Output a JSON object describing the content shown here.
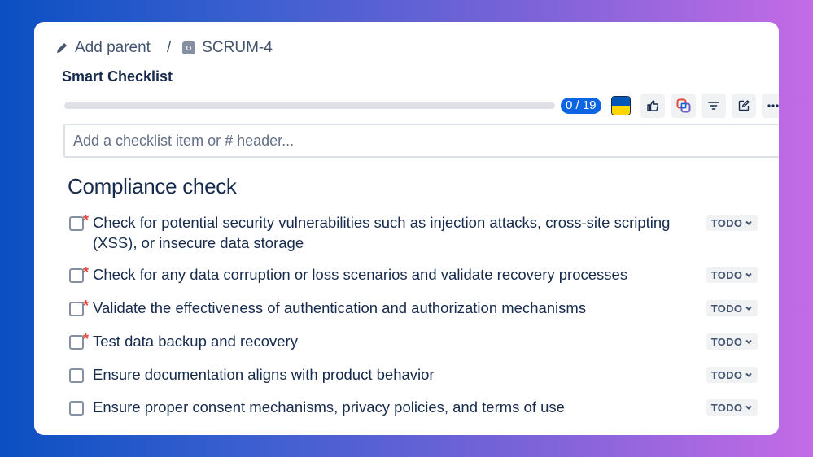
{
  "breadcrumb": {
    "add_parent_label": "Add parent",
    "separator": "/",
    "issue_key": "SCRUM-4"
  },
  "app": {
    "title": "Smart Checklist"
  },
  "progress": {
    "completed": 0,
    "total": 19,
    "label": "0 / 19",
    "fraction": 0.0
  },
  "toolbar": {
    "buttons": [
      "ukraine-flag",
      "thumbs-up",
      "sync",
      "filter",
      "edit",
      "more"
    ]
  },
  "add_item": {
    "placeholder": "Add a checklist item or # header..."
  },
  "section": {
    "header": "Compliance check"
  },
  "items": [
    {
      "text": "Check for potential security vulnerabilities such as injection attacks, cross-site scripting (XSS), or insecure data storage",
      "required": "*",
      "status": "TODO"
    },
    {
      "text": "Check for any data corruption or loss scenarios and validate recovery processes",
      "required": "*",
      "status": "TODO"
    },
    {
      "text": "Validate the effectiveness of authentication and authorization mechanisms",
      "required": "*",
      "status": "TODO"
    },
    {
      "text": "Test data backup and recovery",
      "required": "*",
      "status": "TODO"
    },
    {
      "text": "Ensure documentation aligns with product behavior",
      "required": "",
      "status": "TODO"
    },
    {
      "text": "Ensure proper consent mechanisms, privacy policies, and terms of use",
      "required": "",
      "status": "TODO"
    }
  ],
  "colors": {
    "accent": "#0c66e4",
    "required": "#e2483d",
    "status_bg": "#f1f2f4",
    "flag_blue": "#0057b7",
    "flag_yellow": "#ffd700"
  }
}
